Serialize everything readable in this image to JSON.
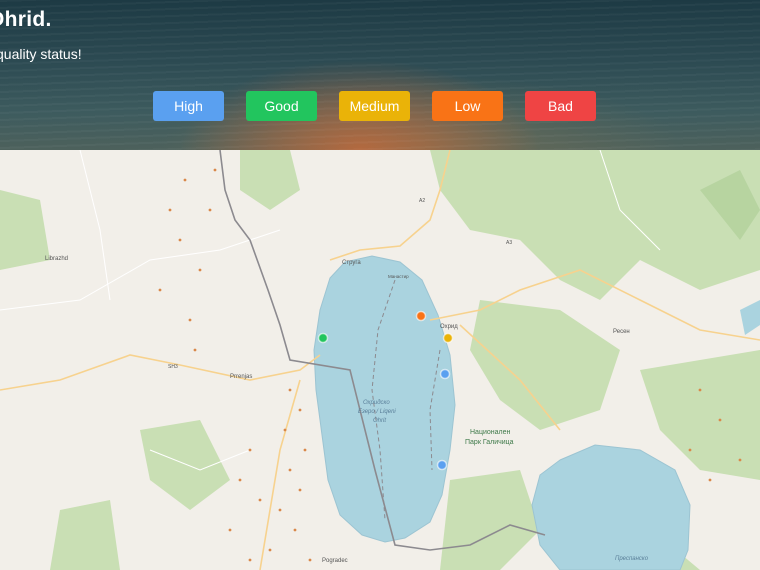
{
  "header": {
    "title": "Ohrid.",
    "subtitle": "quality status!"
  },
  "legend": [
    {
      "label": "High",
      "color": "#5aa0f0"
    },
    {
      "label": "Good",
      "color": "#22c55e"
    },
    {
      "label": "Medium",
      "color": "#eab308"
    },
    {
      "label": "Low",
      "color": "#f97316"
    },
    {
      "label": "Bad",
      "color": "#ef4444"
    }
  ],
  "map": {
    "labels": {
      "struga": "Струга",
      "ohrid": "Охрид",
      "lake": "Охридско",
      "lake2": "Езеро / Liqeni",
      "lake3": "Ohrit",
      "park1": "Национален",
      "park2": "Парк Галичица",
      "prespa": "Преспанско",
      "pogradec": "Pogradec",
      "resen": "Ресен",
      "librazhd": "Librazhd",
      "prrenjas": "Prrenjas",
      "monastery": "Манастир",
      "a2": "A2",
      "a3": "A3",
      "sh3": "SH3"
    },
    "stations": [
      {
        "name": "station-west",
        "status": "good"
      },
      {
        "name": "station-ohrid-north",
        "status": "low"
      },
      {
        "name": "station-ohrid-bay",
        "status": "medium"
      },
      {
        "name": "station-east-middle",
        "status": "high"
      },
      {
        "name": "station-east-south",
        "status": "high"
      }
    ]
  }
}
